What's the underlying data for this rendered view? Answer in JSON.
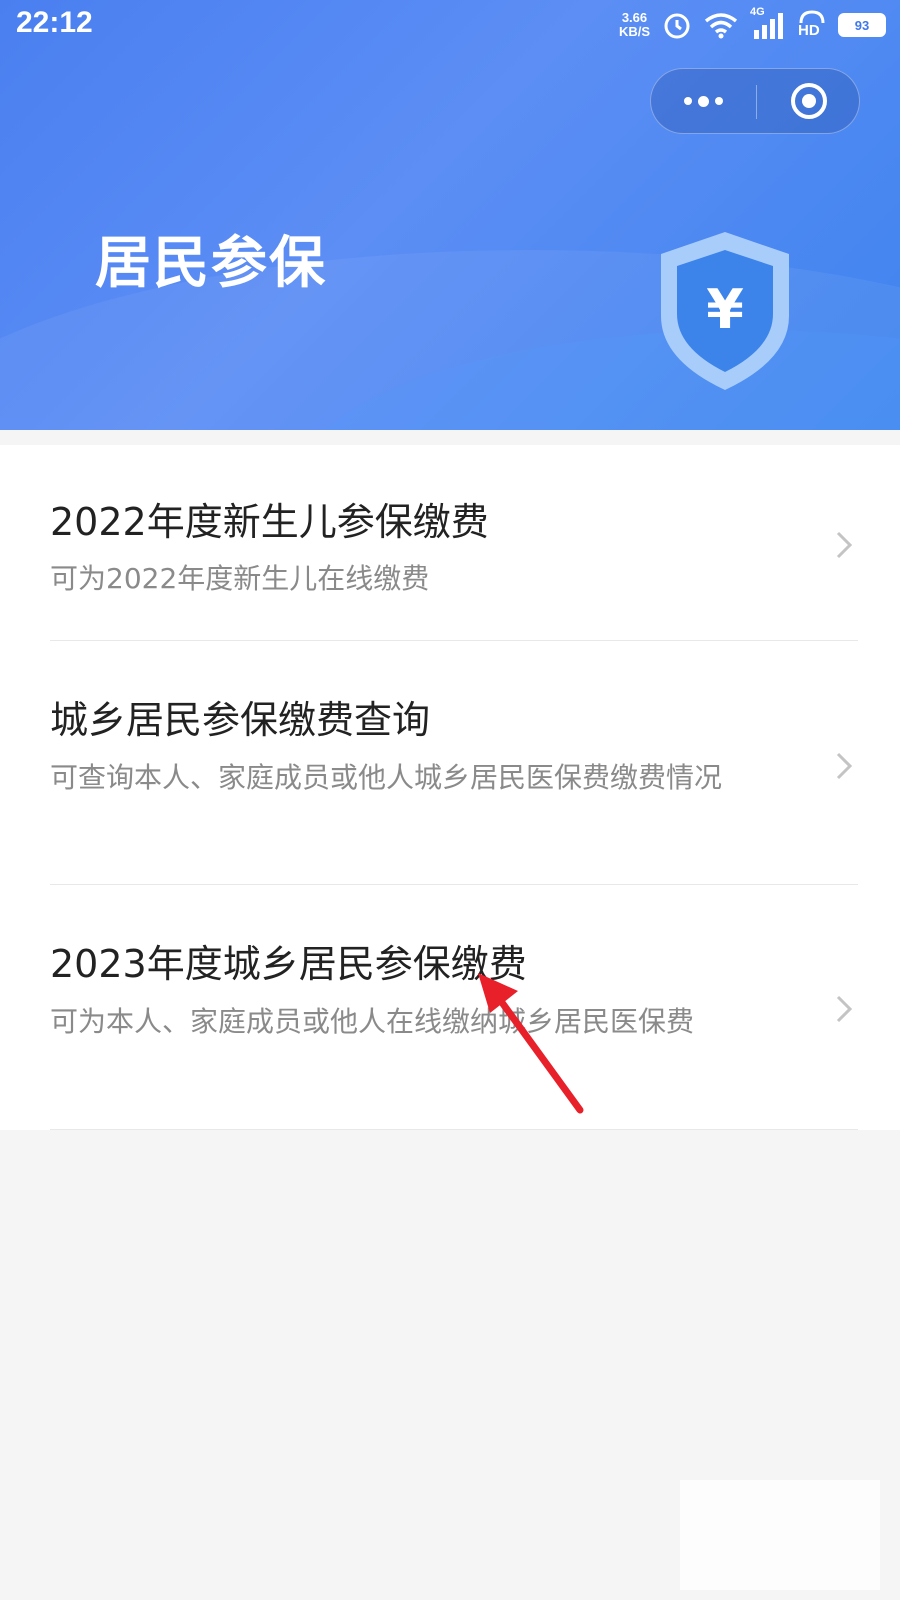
{
  "status_bar": {
    "time": "22:12",
    "net_speed_value": "3.66",
    "net_speed_unit": "KB/S",
    "network": "4G",
    "hd_label": "HD",
    "battery": "93"
  },
  "header": {
    "title": "居民参保",
    "shield_symbol": "¥"
  },
  "colors": {
    "header_blue": "#4a7ff0",
    "annotation_red": "#e8202a"
  },
  "menu": {
    "items": [
      {
        "title": "2022年度新生儿参保缴费",
        "desc": "可为2022年度新生儿在线缴费"
      },
      {
        "title": "城乡居民参保缴费查询",
        "desc": "可查询本人、家庭成员或他人城乡居民医保费缴费情况"
      },
      {
        "title": "2023年度城乡居民参保缴费",
        "desc": "可为本人、家庭成员或他人在线缴纳城乡居民医保费"
      }
    ]
  }
}
